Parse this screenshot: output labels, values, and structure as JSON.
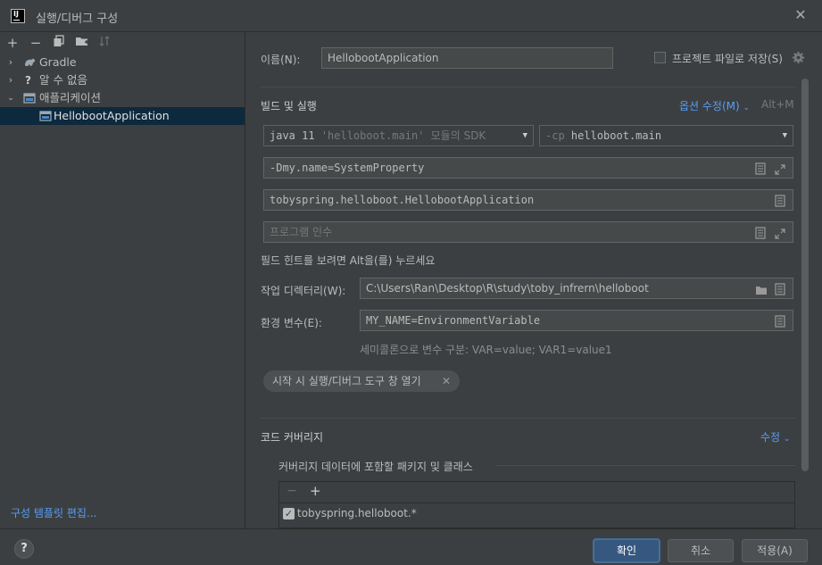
{
  "window": {
    "title": "실행/디버그 구성"
  },
  "tree": {
    "items": [
      {
        "label": "Gradle"
      },
      {
        "label": "알 수 없음"
      },
      {
        "label": "애플리케이션"
      },
      {
        "label": "HellobootApplication"
      }
    ],
    "templates_link": "구성 템플릿 편집..."
  },
  "form": {
    "name_label": "이름(N):",
    "name_value": "HellobootApplication",
    "store_as_file_label": "프로젝트 파일로 저장(S)",
    "build_run_title": "빌드 및 실행",
    "modify_options": "옵션 수정(M)",
    "modify_shortcut": "Alt+M",
    "sdk_prefix": "java 11",
    "sdk_module": "'helloboot.main'",
    "sdk_suffix": "모듈의 SDK",
    "cp_prefix": "-cp",
    "cp_value": "helloboot.main",
    "vm_options": "-Dmy.name=SystemProperty",
    "main_class": "tobyspring.helloboot.HellobootApplication",
    "program_args_placeholder": "프로그램 인수",
    "field_hint": "필드 힌트를 보려면 Alt을(를) 누르세요",
    "workdir_label": "작업 디렉터리(W):",
    "workdir_value": "C:\\Users\\Ran\\Desktop\\R\\study\\toby_infrern\\helloboot",
    "env_label": "환경 변수(E):",
    "env_value": "MY_NAME=EnvironmentVariable",
    "env_hint": "세미콜론으로 변수 구분: VAR=value; VAR1=value1",
    "chip_label": "시작 시 실행/디버그 도구 창 열기",
    "coverage_title": "코드 커버리지",
    "coverage_modify": "수정",
    "coverage_include_label": "커버리지 데이터에 포함할 패키지 및 클래스",
    "coverage_package": "tobyspring.helloboot.*"
  },
  "buttons": {
    "ok": "확인",
    "cancel": "취소",
    "apply": "적용(A)",
    "help": "?"
  }
}
